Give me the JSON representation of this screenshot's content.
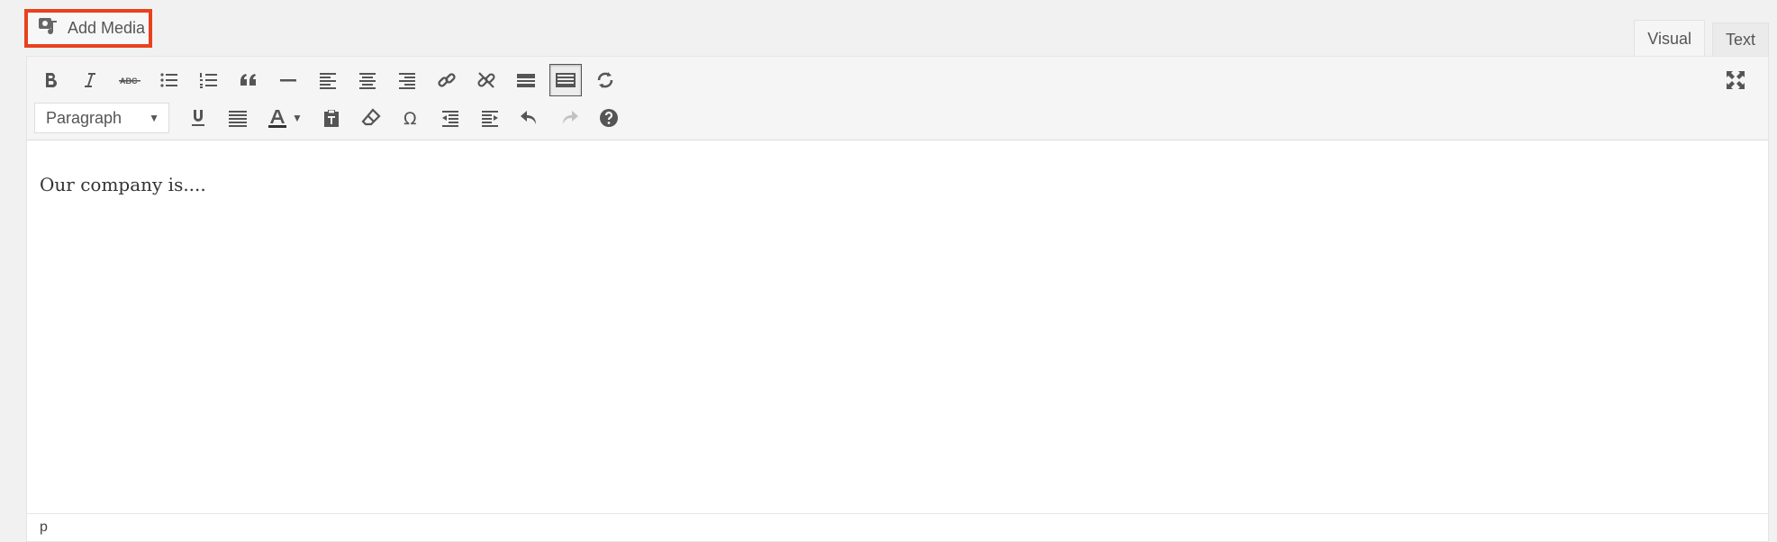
{
  "add_media": {
    "label": "Add Media",
    "icon": "media-icon"
  },
  "tabs": [
    {
      "label": "Visual",
      "active": true
    },
    {
      "label": "Text",
      "active": false
    }
  ],
  "toolbar": {
    "row1": [
      "bold",
      "italic",
      "strikethrough",
      "bulleted-list",
      "numbered-list",
      "blockquote",
      "horizontal-line",
      "align-left",
      "align-center",
      "align-right",
      "insert-link",
      "remove-link",
      "read-more",
      "toolbar-toggle",
      "refresh"
    ],
    "format_select": "Paragraph",
    "row2": [
      "underline",
      "justify",
      "text-color",
      "paste-as-text",
      "clear-formatting",
      "special-character",
      "decrease-indent",
      "increase-indent",
      "undo",
      "redo",
      "help"
    ],
    "glyphs": {
      "strikethrough": "ABC",
      "special_character": "Ω"
    }
  },
  "content": {
    "text": "Our company is...."
  },
  "status_path": "p"
}
